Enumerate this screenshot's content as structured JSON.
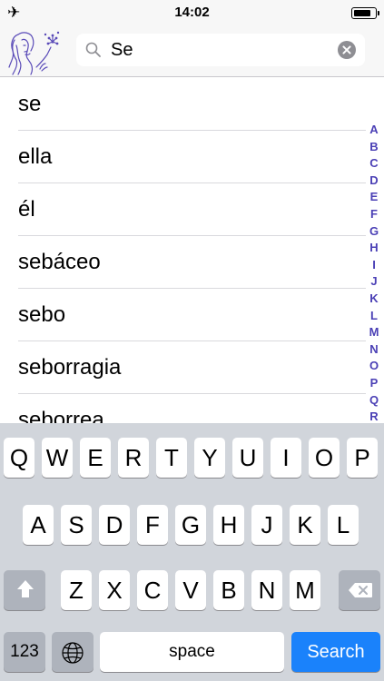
{
  "status_bar": {
    "time": "14:02",
    "airplane_icon": "airplane-icon",
    "battery_level": 0.85
  },
  "header": {
    "logo_icon": "woman-dandelion-logo-icon",
    "search": {
      "value": "Se",
      "icon": "search-icon",
      "clear_icon": "clear-icon"
    }
  },
  "words": [
    "se",
    "ella",
    "él",
    "sebáceo",
    "sebo",
    "seborragia",
    "seborrea"
  ],
  "index_letters": [
    "A",
    "B",
    "C",
    "D",
    "E",
    "F",
    "G",
    "H",
    "I",
    "J",
    "K",
    "L",
    "M",
    "N",
    "O",
    "P",
    "Q",
    "R"
  ],
  "colors": {
    "index_accent": "#4a3fb5",
    "logo_stroke": "#5a4bb8",
    "search_key": "#1a82fb"
  },
  "keyboard": {
    "row1": [
      "Q",
      "W",
      "E",
      "R",
      "T",
      "Y",
      "U",
      "I",
      "O",
      "P"
    ],
    "row2": [
      "A",
      "S",
      "D",
      "F",
      "G",
      "H",
      "J",
      "K",
      "L"
    ],
    "row3": [
      "Z",
      "X",
      "C",
      "V",
      "B",
      "N",
      "M"
    ],
    "numbers_label": "123",
    "space_label": "space",
    "search_label": "Search",
    "shift_icon": "shift-icon",
    "delete_icon": "delete-icon",
    "globe_icon": "globe-icon"
  }
}
